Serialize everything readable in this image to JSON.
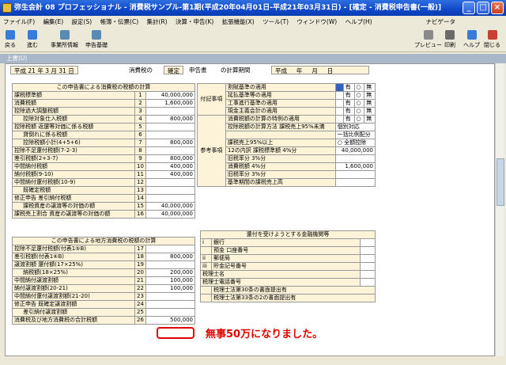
{
  "window": {
    "title": "弥生会計 08 プロフェッショナル - 消費税サンプル-第1期(平成20年04月01日-平成21年03月31日) - [確定 - 消費税申告書(一般)]"
  },
  "menu": [
    "ファイル(F)",
    "編集(E)",
    "設定(S)",
    "帳簿・伝票(C)",
    "集計(R)",
    "決算・申告(K)",
    "拡張機能(X)",
    "ツール(T)",
    "ウィンドウ(W)",
    "ヘルプ(H)"
  ],
  "navi_label": "ナビゲータ",
  "toolbar": {
    "back": "戻る",
    "forward": "進む",
    "biz_info": "事業所情報",
    "declare_basis": "申告基礎",
    "preview": "プレビュー",
    "print": "印刷",
    "help": "ヘルプ",
    "close": "閉じる"
  },
  "tab_label": "上書(U)",
  "period": {
    "era": "平成",
    "from_year": "21",
    "year": "年",
    "from_month": "3",
    "month": "月",
    "from_day": "31",
    "day": "日",
    "doc_name": "消費税の",
    "doc_state": "確定",
    "doc_type": "申告書",
    "interim_label": "の計算期間",
    "to_era": "平成",
    "to_year": "年",
    "to_month": "月",
    "to_day": "日"
  },
  "left_section_title": "この申告書による消費税の税額の計算",
  "left_rows": [
    {
      "label": "課税標準額",
      "num": "1",
      "value": "40,000,000"
    },
    {
      "label": "消費税額",
      "num": "2",
      "value": "1,600,000"
    },
    {
      "label": "控除過大調整税額",
      "num": "3",
      "value": ""
    },
    {
      "label": "控除対象仕入税額",
      "num": "4",
      "value": "800,000"
    },
    {
      "label": "返還等対価に係る税額",
      "num": "5",
      "value": ""
    },
    {
      "label": "貸倒れに係る税額",
      "num": "6",
      "value": ""
    },
    {
      "label": "控除税額小計(4+5+6)",
      "num": "7",
      "value": "800,000"
    },
    {
      "label": "控除不足還付税額(7-2-3)",
      "num": "8",
      "value": ""
    },
    {
      "label": "差引税額(2+3-7)",
      "num": "9",
      "value": "800,000"
    },
    {
      "label": "中間納付税額",
      "num": "10",
      "value": "400,000"
    },
    {
      "label": "納付税額(9-10)",
      "num": "11",
      "value": "400,000"
    },
    {
      "label": "中間納付還付税額(10-9)",
      "num": "12",
      "value": ""
    },
    {
      "label": "既確定税額",
      "num": "13",
      "value": ""
    },
    {
      "label": "差引納付税額",
      "num": "14",
      "value": ""
    },
    {
      "label": "課税資産の譲渡等の対価の額",
      "num": "15",
      "value": "40,000,000"
    },
    {
      "label": "資産の譲渡等の対価の額",
      "num": "16",
      "value": "40,000,000"
    }
  ],
  "left_group_labels": {
    "deduct": "控除税額",
    "correction": "修正申告",
    "ratio": "課税売上割合"
  },
  "local_section_title": "この申告書による地方消費税の税額の計算",
  "local_rows": [
    {
      "label": "控除不足還付税額(付表1⑤B)",
      "num": "17",
      "value": ""
    },
    {
      "label": "差引税額(付表1⑥B)",
      "num": "18",
      "value": "800,000"
    },
    {
      "label": "還付額(17×25%)",
      "num": "19",
      "value": ""
    },
    {
      "label": "納税額(18×25%)",
      "num": "20",
      "value": "200,000"
    },
    {
      "label": "中間納付譲渡割額",
      "num": "21",
      "value": "100,000"
    },
    {
      "label": "納付譲渡割額(20-21)",
      "num": "22",
      "value": "100,000"
    },
    {
      "label": "中間納付還付譲渡割額(21-20)",
      "num": "23",
      "value": ""
    },
    {
      "label": "既確定譲渡割額",
      "num": "24",
      "value": ""
    },
    {
      "label": "差引納付譲渡割額",
      "num": "25",
      "value": ""
    },
    {
      "label": "消費税及び地方消費税の合計税額",
      "num": "26",
      "value": "500,000"
    }
  ],
  "local_group_labels": {
    "transfer": "譲渡割額",
    "correction": "修正申告"
  },
  "right_top_rows": [
    {
      "label": "割賦基準の適用",
      "yes": "有",
      "no": "無"
    },
    {
      "label": "延払基準等の適用",
      "yes": "有",
      "no": "無"
    },
    {
      "label": "工事進行基準の適用",
      "yes": "有",
      "no": "無"
    },
    {
      "label": "現金主義会計の適用",
      "yes": "有",
      "no": "無"
    },
    {
      "label": "消費税額の計算の特例の適用",
      "yes": "有",
      "no": "無"
    }
  ],
  "right_group_labels": {
    "appended": "付記事項",
    "reference": "参考事項",
    "deduction_method": "控除税額の計算方法",
    "breakdown": "12の内訳"
  },
  "deduction_method": {
    "under95": "課税売上95%未満",
    "over95": "課税売上95%以上",
    "opt1": "個別対応",
    "opt2": "一括比例配分",
    "opt3": "全額控除"
  },
  "breakdown": {
    "taxable_std": "課税標準額",
    "rate4": "4%分",
    "old_rate": "旧税率分",
    "rate3": "3%分",
    "consumption": "消費税額",
    "val_std": "40,000,000",
    "val_tax": "1,600,000"
  },
  "base_period_label": "基準期間の課税売上高",
  "bank_title": "還付を受けようとする金融機関等",
  "bank": {
    "bank": "銀行",
    "deposit": "預金",
    "account": "口座番号",
    "post": "郵便局",
    "savings": "貯金記号番号",
    "tax_name": "税理士名",
    "tax_tel": "税理士電話番号",
    "clause30": "税理士法第30条の書面提出有",
    "clause33": "税理士法第33条の2の書面提出有"
  },
  "annotation": "無事50万になりました。"
}
